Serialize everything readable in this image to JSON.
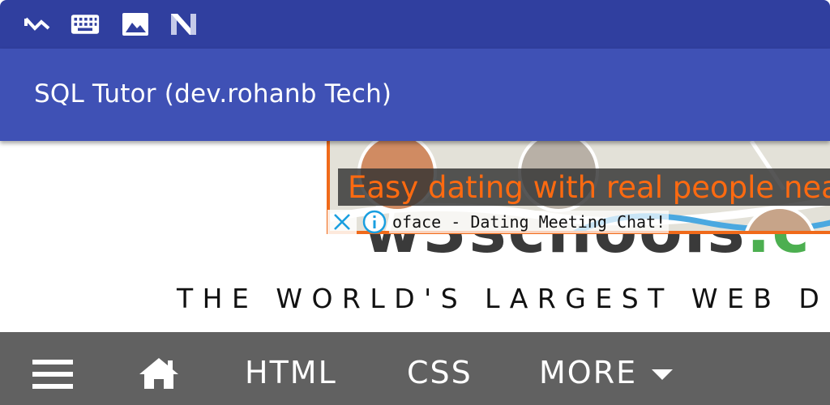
{
  "status_bar": {
    "icons": [
      "missed-call-icon",
      "keyboard-icon",
      "image-icon",
      "n-logo-icon"
    ]
  },
  "app_bar": {
    "title": "SQL Tutor (dev.rohanb Tech)"
  },
  "page": {
    "logo": {
      "main": "w3schools",
      "suffix": ".c"
    },
    "tagline": "THE WORLD'S LARGEST WEB DE"
  },
  "ad": {
    "headline": "Easy dating with real people near",
    "source": "oface - Dating Meeting Chat!",
    "close_icon": "close-icon",
    "info_icon": "info-icon",
    "colors": {
      "border": "#f06a1a",
      "headline": "#ff6a10",
      "controls": "#1a9fe0"
    }
  },
  "nav": {
    "menu_icon": "hamburger-menu-icon",
    "home_icon": "home-icon",
    "items": [
      "HTML",
      "CSS",
      "MORE"
    ],
    "more_icon": "caret-down-icon"
  },
  "colors": {
    "status_bar": "#303f9f",
    "app_bar": "#3f51b5",
    "nav_bar": "#616161"
  }
}
